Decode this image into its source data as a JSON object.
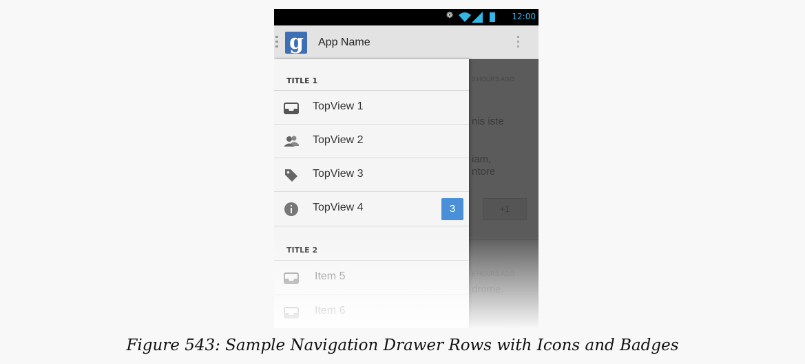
{
  "status_bar": {
    "time": "12:00",
    "icons": [
      "bluetooth-icon",
      "wifi-icon",
      "signal-icon",
      "battery-icon"
    ]
  },
  "action_bar": {
    "title": "App Name",
    "logo_icon": "app-logo-icon",
    "overflow_icon": "overflow-menu-icon"
  },
  "drawer": {
    "sections": [
      {
        "title": "TITLE 1",
        "items": [
          {
            "label": "TopView 1",
            "icon": "inbox-icon"
          },
          {
            "label": "TopView 2",
            "icon": "people-icon"
          },
          {
            "label": "TopView 3",
            "icon": "tag-icon"
          },
          {
            "label": "TopView 4",
            "icon": "info-icon",
            "badge": "3"
          }
        ]
      },
      {
        "title": "TITLE 2",
        "items": [
          {
            "label": "Item 5",
            "icon": "inbox-icon"
          },
          {
            "label": "Item 6",
            "icon": "inbox-icon"
          }
        ]
      }
    ],
    "colors": {
      "badge": "#4a90d9",
      "background": "#f5f5f5"
    }
  },
  "background_content": {
    "timestamp1": "3 HOURS AGO",
    "text1": "nis iste",
    "text2a": "iam,",
    "text2b": "ntore",
    "plus_button": "+1",
    "timestamp2": "6 HOURS AGO",
    "text3": "drome."
  },
  "caption": "Figure 543: Sample Navigation Drawer Rows with Icons and Badges"
}
